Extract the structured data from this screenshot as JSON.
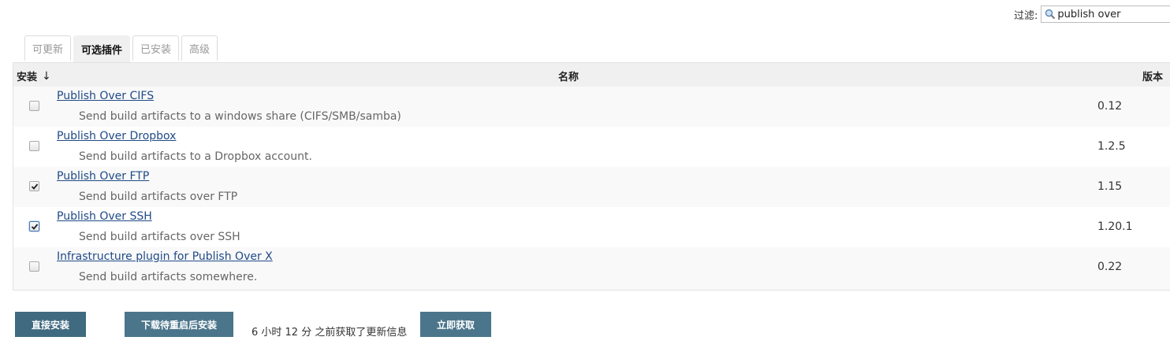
{
  "filter": {
    "label": "过滤:",
    "value": "publish over"
  },
  "tabs": [
    {
      "label": "可更新",
      "active": false
    },
    {
      "label": "可选插件",
      "active": true
    },
    {
      "label": "已安装",
      "active": false
    },
    {
      "label": "高级",
      "active": false
    }
  ],
  "table": {
    "headers": {
      "install": "安装",
      "sort_arrow": "↓",
      "name": "名称",
      "version": "版本"
    },
    "rows": [
      {
        "name": "Publish Over CIFS",
        "description": "Send build artifacts to a windows share (CIFS/SMB/samba)",
        "version": "0.12",
        "checked": false
      },
      {
        "name": "Publish Over Dropbox",
        "description": "Send build artifacts to a Dropbox account.",
        "version": "1.2.5",
        "checked": false
      },
      {
        "name": "Publish Over FTP",
        "description": "Send build artifacts over FTP",
        "version": "1.15",
        "checked": true
      },
      {
        "name": "Publish Over SSH",
        "description": "Send build artifacts over SSH",
        "version": "1.20.1",
        "checked": true
      },
      {
        "name": "Infrastructure plugin for Publish Over X",
        "description": "Send build artifacts somewhere.",
        "version": "0.22",
        "checked": false
      }
    ]
  },
  "actions": {
    "install_now": "直接安装",
    "download_restart": "下载待重启后安装",
    "update_info": "6 小时 12 分 之前获取了更新信息",
    "fetch_now": "立即获取"
  },
  "colors": {
    "link": "#204a87",
    "button": "#4b758b",
    "header_bg": "#f0f0f0"
  }
}
